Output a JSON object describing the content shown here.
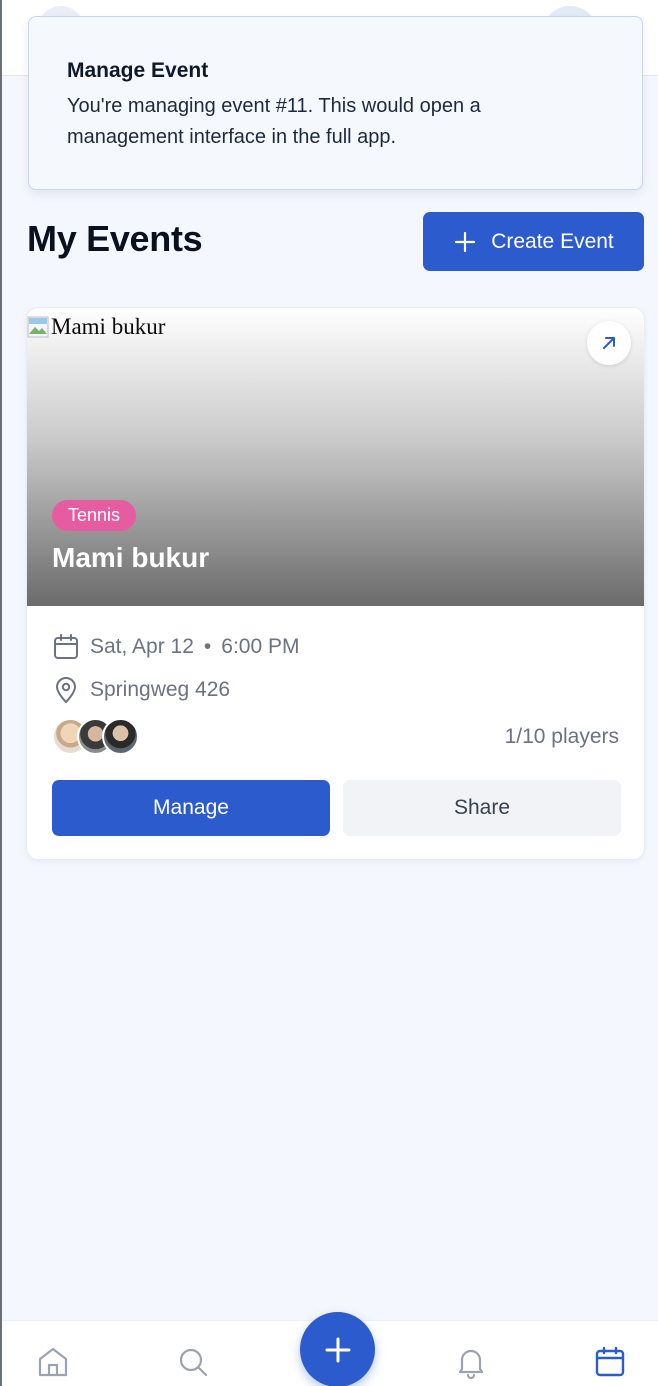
{
  "toast": {
    "title": "Manage Event",
    "message": "You're managing event #11. This would open a management interface in the full app."
  },
  "page": {
    "title": "My Events",
    "create_button_label": "Create Event"
  },
  "events": [
    {
      "image_alt": "Mami bukur",
      "sport": "Tennis",
      "name": "Mami bukur",
      "date": "Sat, Apr 12",
      "time": "6:00 PM",
      "date_separator": "•",
      "location": "Springweg 426",
      "players": "1/10 players",
      "manage_label": "Manage",
      "share_label": "Share"
    }
  ],
  "bottom_nav": {
    "items": [
      "home-icon",
      "search-icon",
      "add-icon",
      "bell-icon",
      "calendar-icon"
    ],
    "active": "calendar-icon"
  },
  "colors": {
    "primary": "#2b5bcc",
    "badge": "#e65ca0",
    "background": "#f4f7fd",
    "muted_text": "#6b7280"
  }
}
